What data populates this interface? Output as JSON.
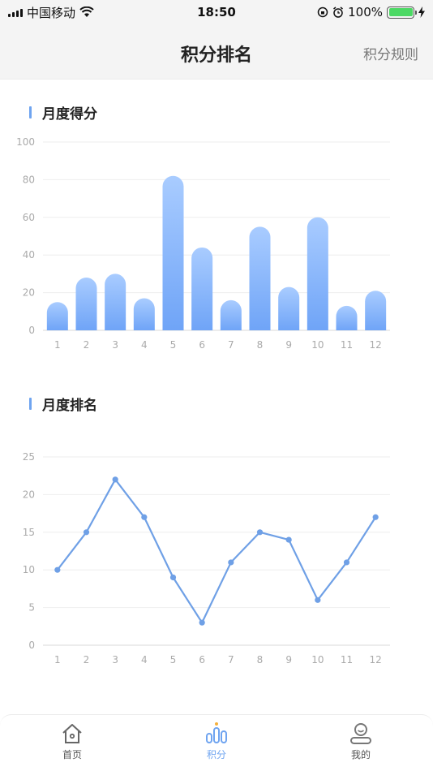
{
  "status_bar": {
    "carrier": "中国移动",
    "time": "18:50",
    "battery_percent": "100%",
    "battery_level": 1.0
  },
  "nav": {
    "title": "积分排名",
    "action": "积分规则"
  },
  "score_section": {
    "title": "月度得分"
  },
  "rank_section": {
    "title": "月度排名"
  },
  "chart_data": [
    {
      "type": "bar",
      "categories": [
        "1",
        "2",
        "3",
        "4",
        "5",
        "6",
        "7",
        "8",
        "9",
        "10",
        "11",
        "12"
      ],
      "values": [
        15,
        28,
        30,
        17,
        82,
        44,
        16,
        55,
        23,
        60,
        13,
        21
      ],
      "ylim": [
        0,
        100
      ],
      "yticks": [
        0,
        20,
        40,
        60,
        80,
        100
      ],
      "grid": true,
      "colors": {
        "bar_top": "#a9ccff",
        "bar_bottom": "#6fa4f7"
      }
    },
    {
      "type": "line",
      "categories": [
        "1",
        "2",
        "3",
        "4",
        "5",
        "6",
        "7",
        "8",
        "9",
        "10",
        "11",
        "12"
      ],
      "values": [
        10,
        15,
        22,
        17,
        9,
        3,
        11,
        15,
        14,
        6,
        11,
        17
      ],
      "ylim": [
        0,
        25
      ],
      "yticks": [
        0,
        5,
        10,
        15,
        20,
        25
      ],
      "grid": true,
      "colors": {
        "line": "#6fa0e6"
      }
    }
  ],
  "tabs": [
    {
      "label": "首页",
      "icon": "home-icon",
      "active": false
    },
    {
      "label": "积分",
      "icon": "points-chart-icon",
      "active": true
    },
    {
      "label": "我的",
      "icon": "profile-icon",
      "active": false
    }
  ]
}
